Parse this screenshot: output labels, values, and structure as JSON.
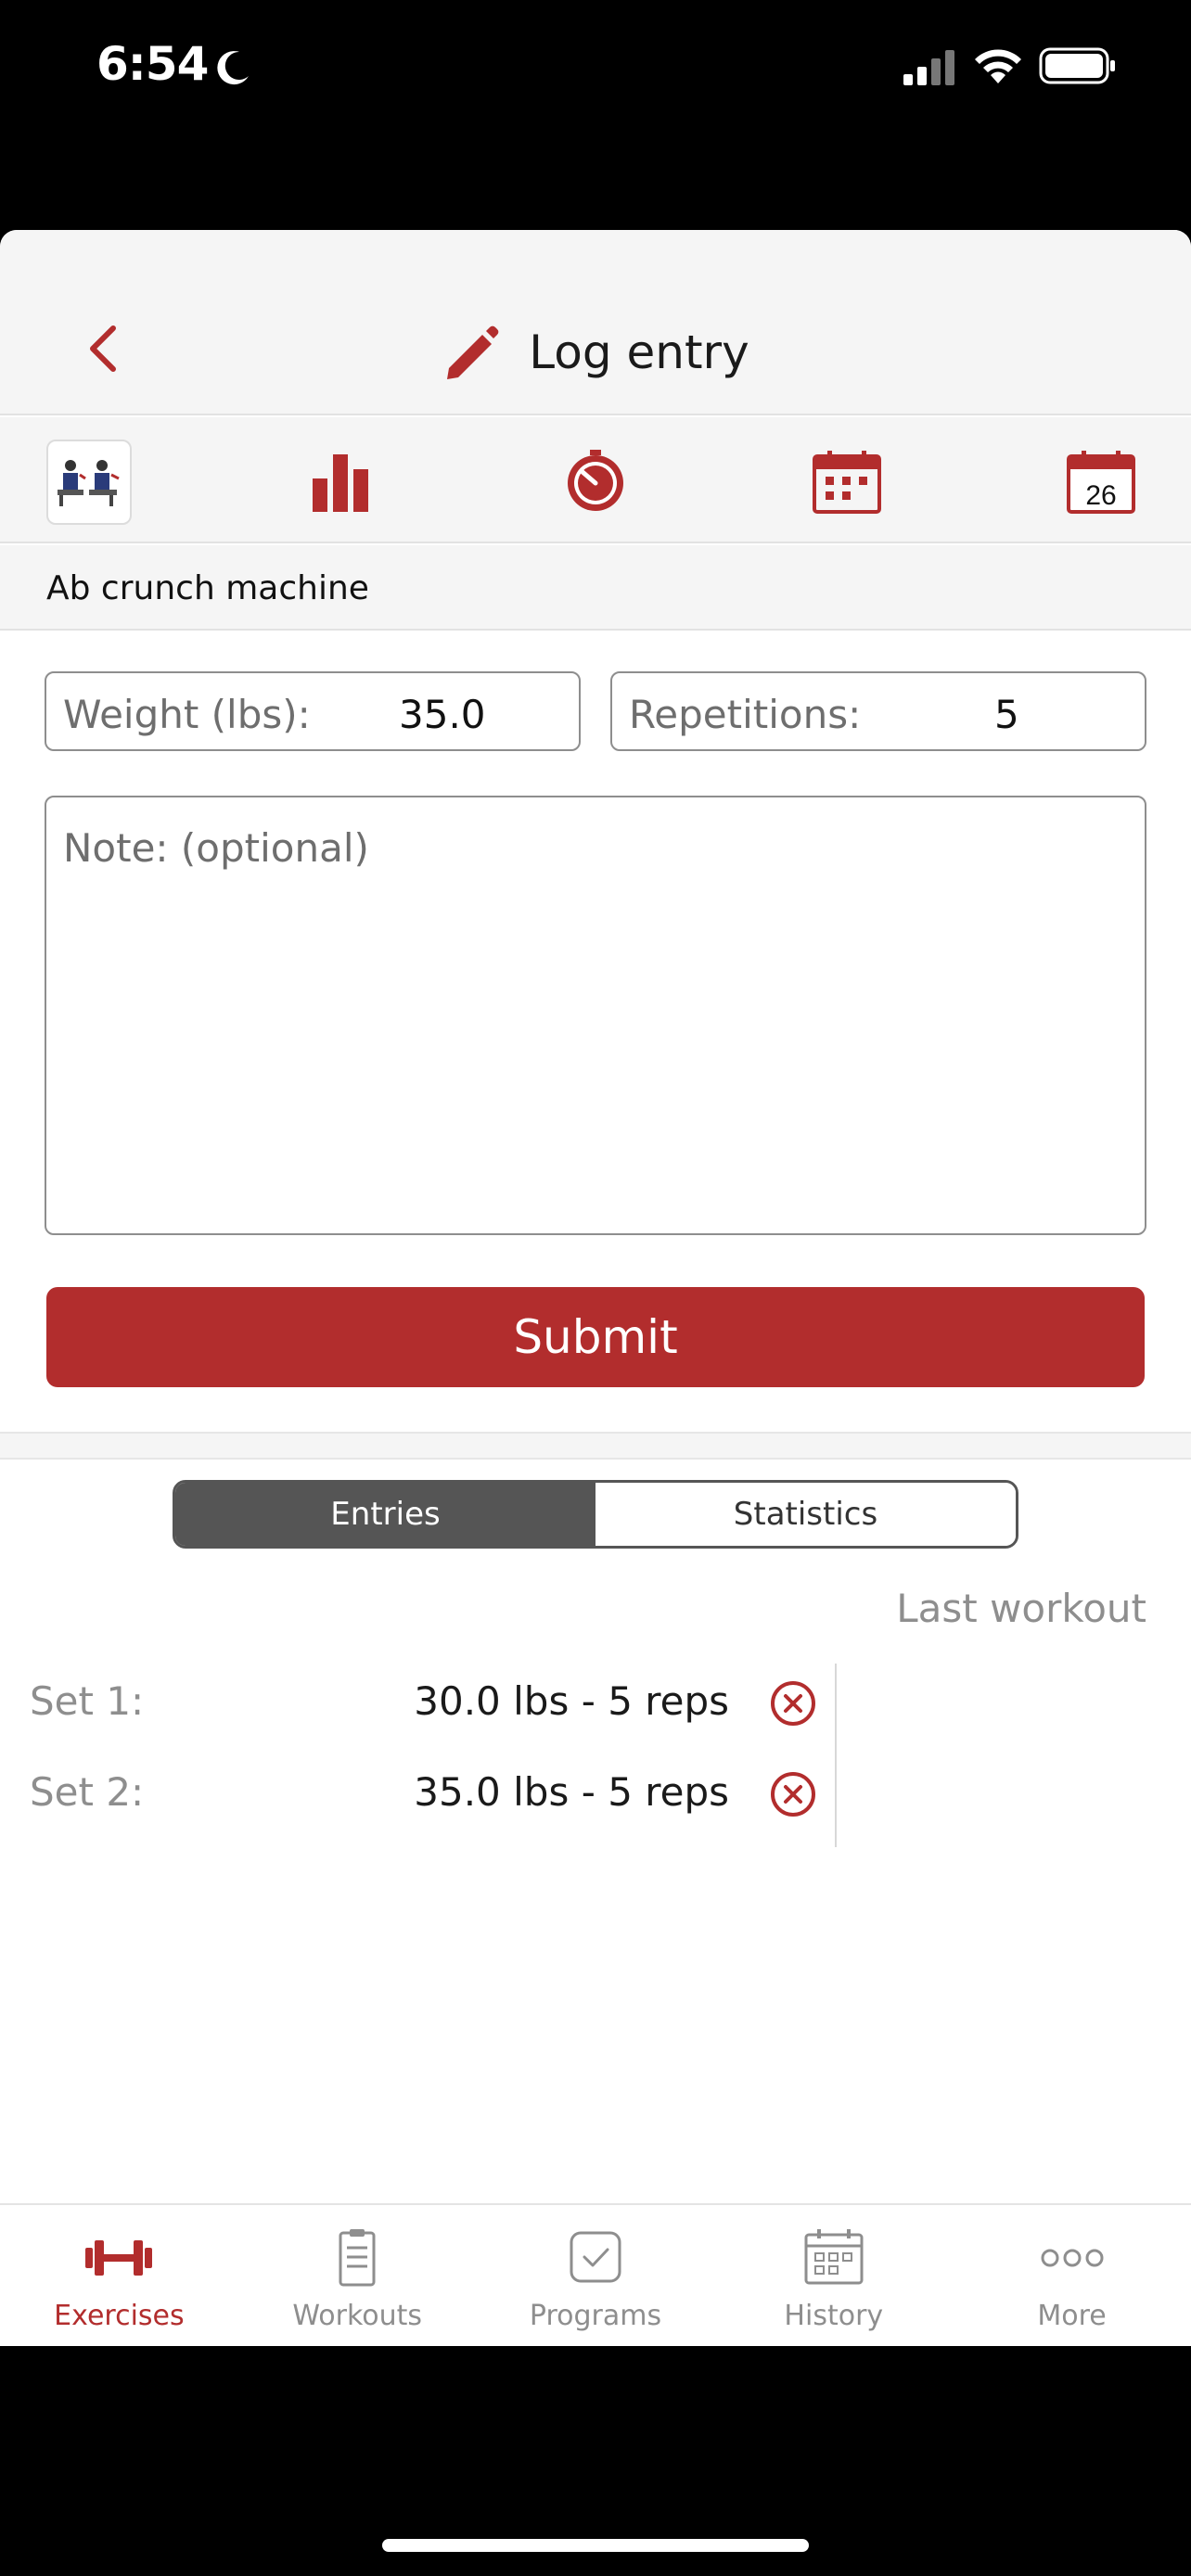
{
  "status_bar": {
    "time": "6:54"
  },
  "header": {
    "title": "Log entry"
  },
  "toolbar": {
    "items": [
      {
        "name": "exercise-thumbnail"
      },
      {
        "name": "bar-chart-icon"
      },
      {
        "name": "timer-icon"
      },
      {
        "name": "calendar-grid-icon"
      },
      {
        "name": "calendar-day-icon",
        "day": "26"
      }
    ]
  },
  "exercise": {
    "name": "Ab crunch machine"
  },
  "form": {
    "weight_label": "Weight (lbs):",
    "weight_value": "35.0",
    "reps_label": "Repetitions:",
    "reps_value": "5",
    "note_placeholder": "Note: (optional)",
    "submit_label": "Submit"
  },
  "segments": {
    "entries": "Entries",
    "statistics": "Statistics",
    "selected": "Entries"
  },
  "last_workout_label": "Last workout",
  "sets": [
    {
      "label": "Set 1:",
      "value": "30.0 lbs - 5 reps"
    },
    {
      "label": "Set 2:",
      "value": "35.0 lbs - 5 reps"
    }
  ],
  "tabbar": {
    "items": [
      {
        "label": "Exercises",
        "icon": "dumbbell-icon",
        "active": true
      },
      {
        "label": "Workouts",
        "icon": "clipboard-icon",
        "active": false
      },
      {
        "label": "Programs",
        "icon": "checkbox-icon",
        "active": false
      },
      {
        "label": "History",
        "icon": "calendar-icon",
        "active": false
      },
      {
        "label": "More",
        "icon": "more-dots-icon",
        "active": false
      }
    ]
  },
  "colors": {
    "accent": "#b22d2d",
    "segment_active": "#555555",
    "muted": "#8e8e8e"
  }
}
